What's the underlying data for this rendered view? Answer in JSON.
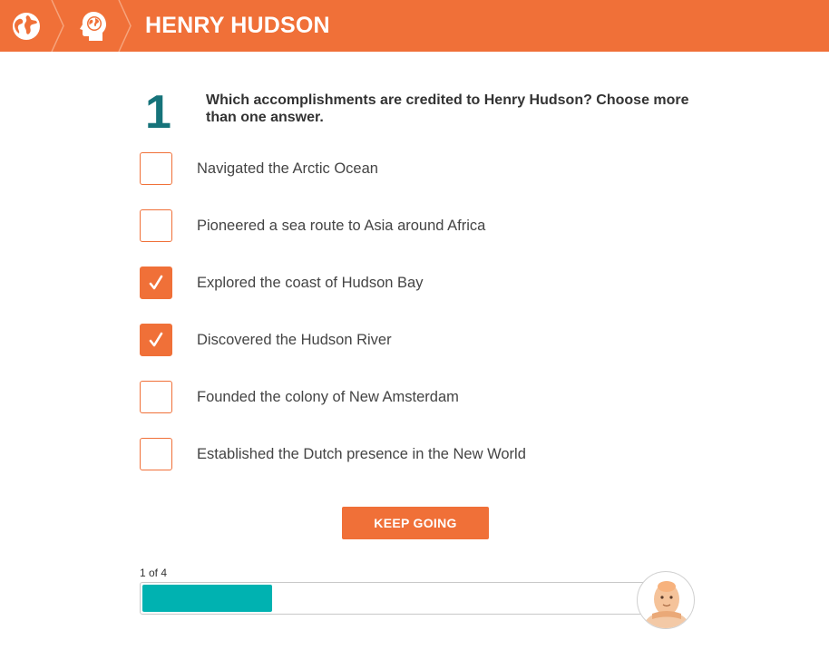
{
  "header": {
    "title": "HENRY HUDSON",
    "icons": [
      "globe-icon",
      "head-globe-icon"
    ],
    "color": "#f07038"
  },
  "question": {
    "number": "1",
    "text": "Which accomplishments are credited to Henry Hudson? Choose more than one answer."
  },
  "options": [
    {
      "label": "Navigated the Arctic Ocean",
      "checked": false
    },
    {
      "label": "Pioneered a sea route to Asia around Africa",
      "checked": false
    },
    {
      "label": "Explored the coast of Hudson Bay",
      "checked": true
    },
    {
      "label": "Discovered the Hudson River",
      "checked": true
    },
    {
      "label": "Founded the colony of New Amsterdam",
      "checked": false
    },
    {
      "label": "Established the Dutch presence in the New World",
      "checked": false
    }
  ],
  "actions": {
    "keep_going": "KEEP GOING"
  },
  "progress": {
    "label": "1 of 4",
    "fraction": 0.25,
    "color": "#00b2b1"
  },
  "colors": {
    "accent": "#f07038",
    "number": "#16737a"
  }
}
